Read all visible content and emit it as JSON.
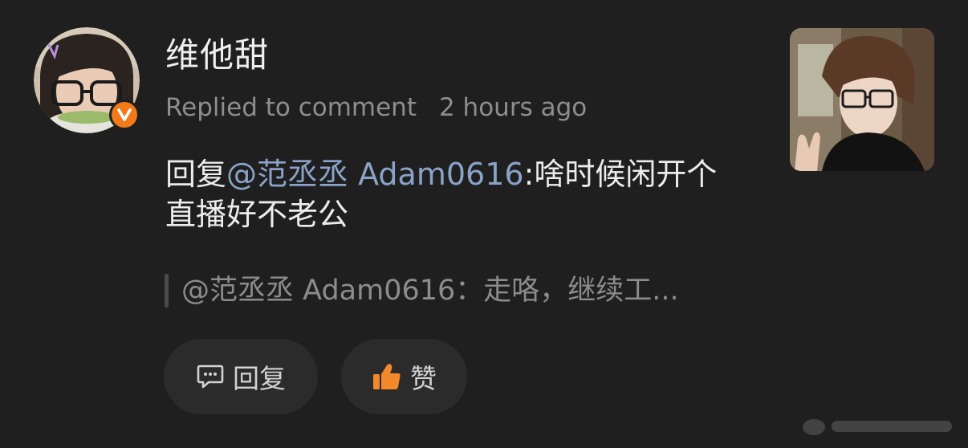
{
  "user": {
    "name": "维他甜",
    "action": "Replied to comment",
    "time": "2 hours ago"
  },
  "comment": {
    "prefix": "回复",
    "mention": "@范丞丞 Adam0616",
    "body": ":啥时候闲开个直播好不老公"
  },
  "quote": {
    "text": "@范丞丞 Adam0616：走咯，继续工..."
  },
  "actions": {
    "reply_label": "回复",
    "like_label": "赞"
  },
  "colors": {
    "background": "#1f1f1f",
    "mention": "#8ba3c8",
    "badge": "#f27a1a",
    "like_icon": "#f28a2c"
  },
  "icons": {
    "verified": "verified-v-icon",
    "reply": "comment-bubble-icon",
    "like": "thumbs-up-icon"
  }
}
